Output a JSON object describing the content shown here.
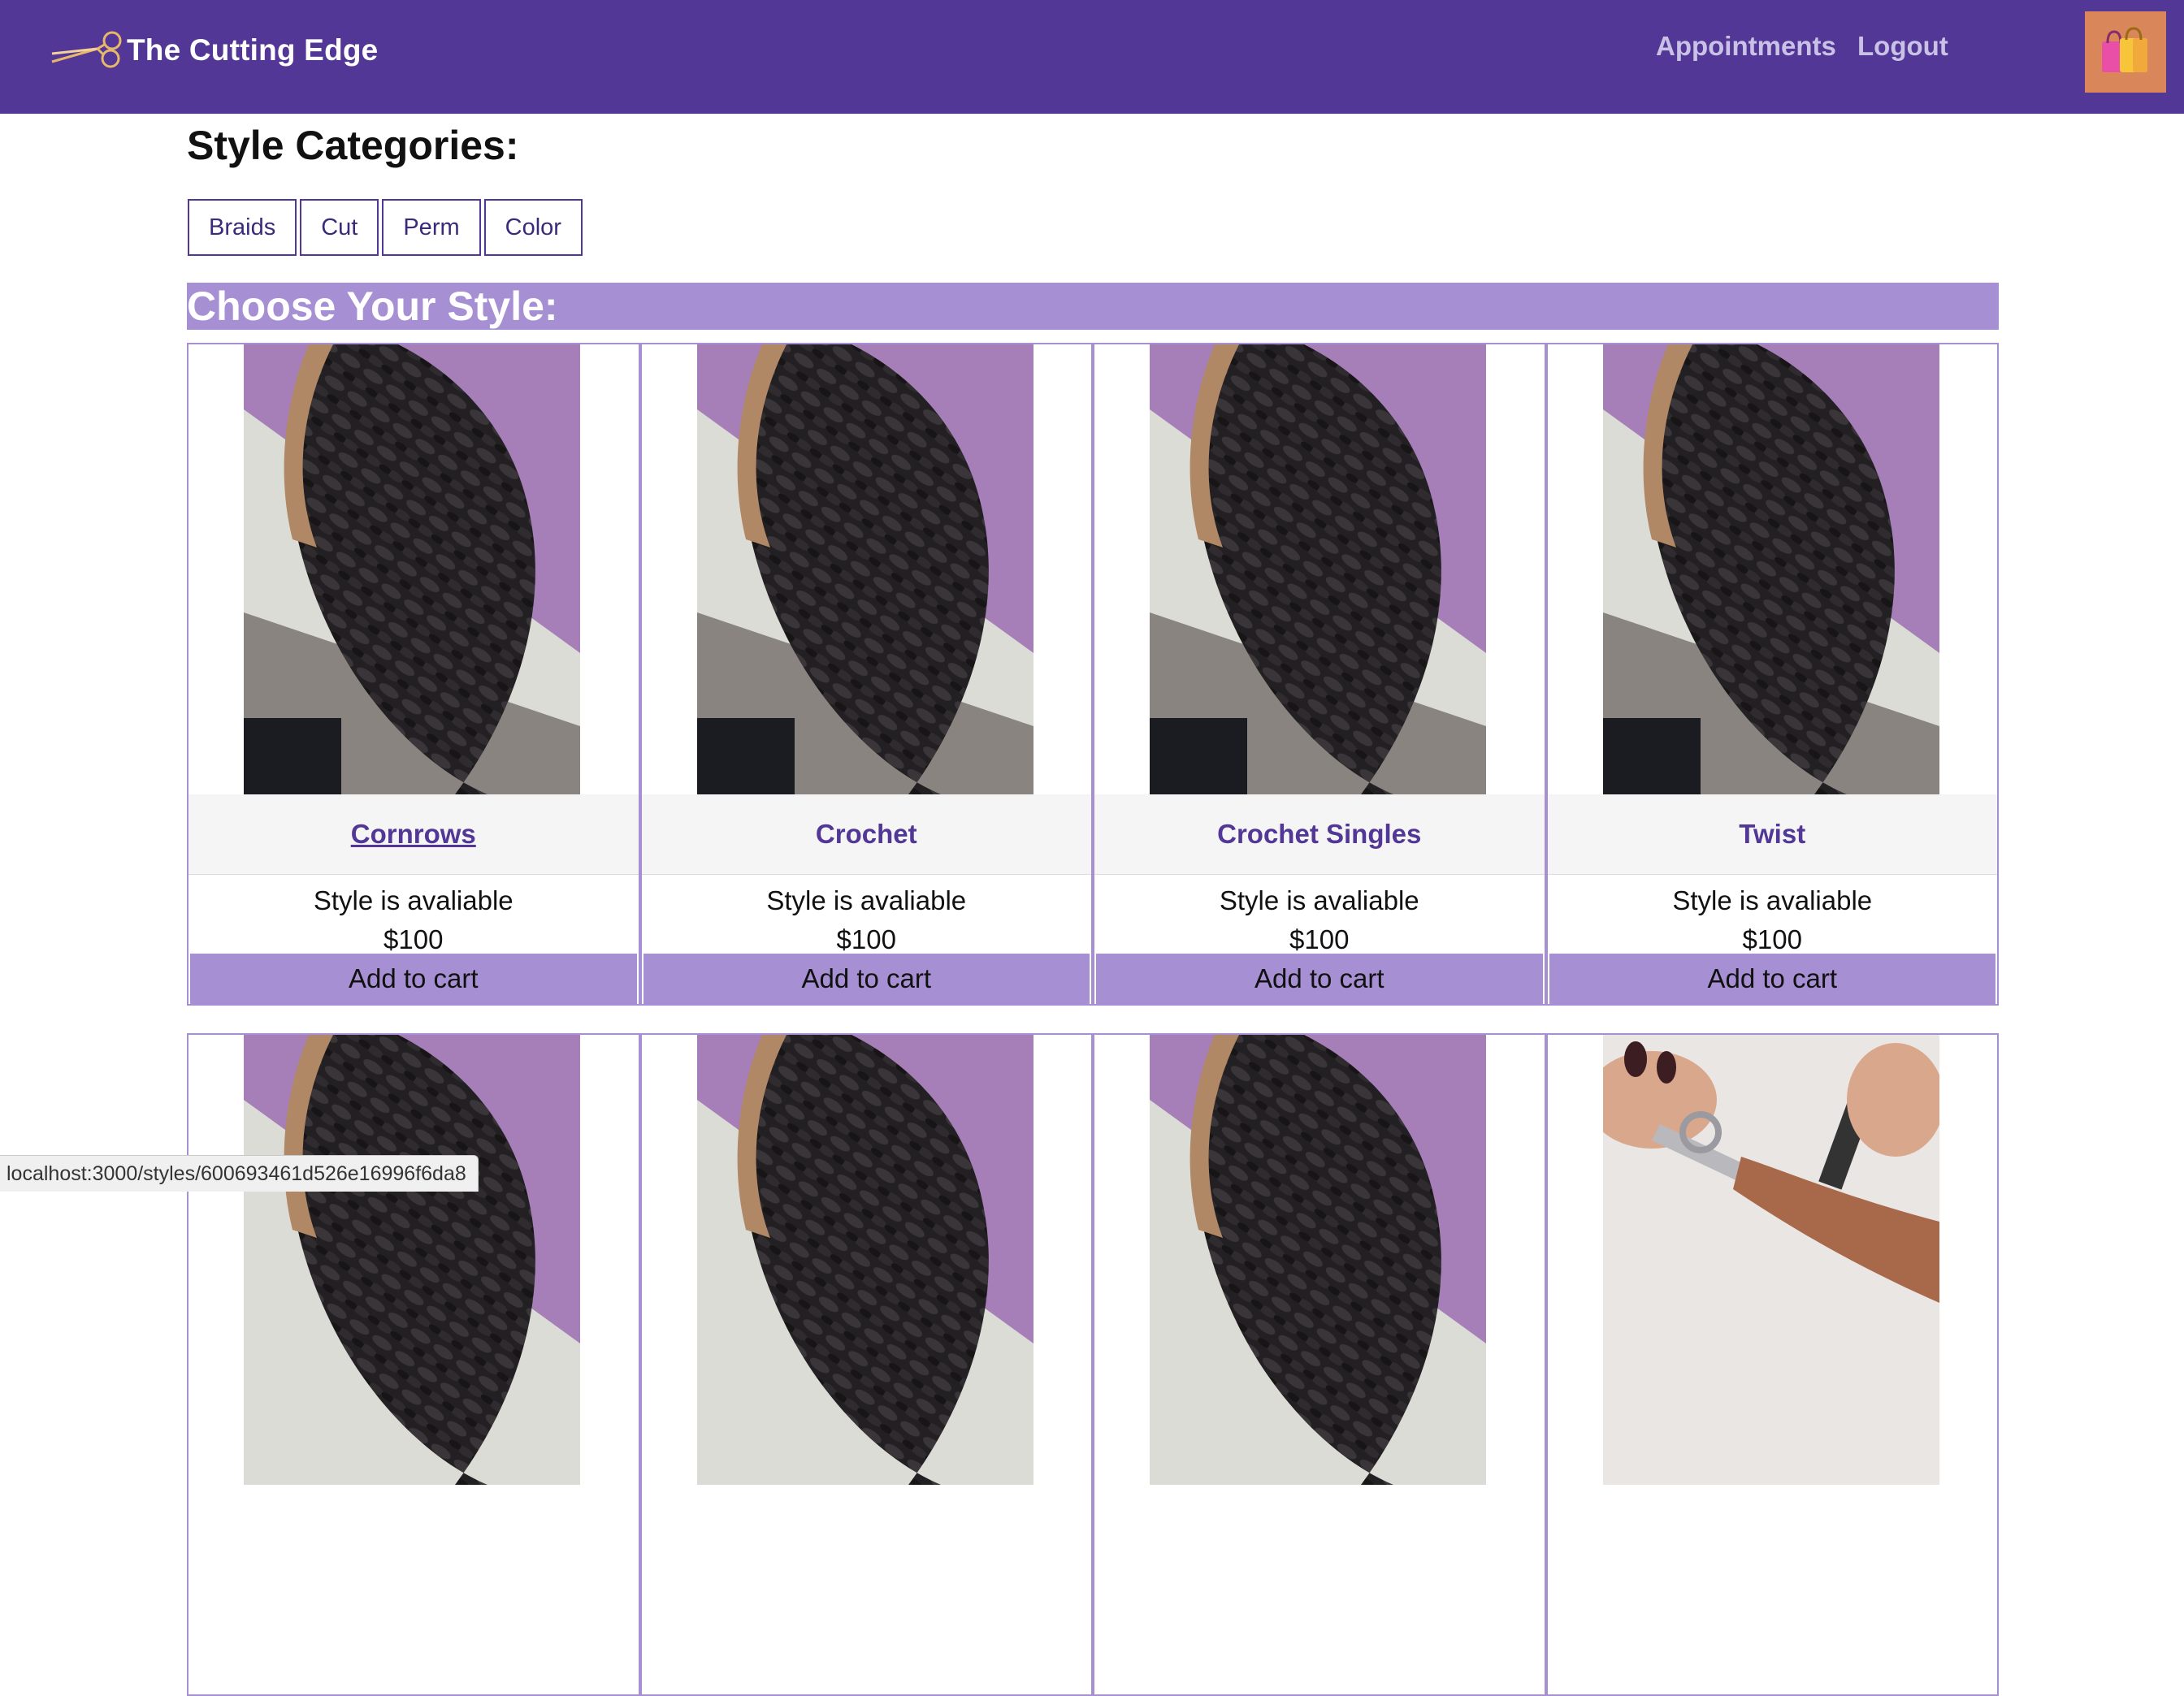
{
  "navbar": {
    "brand": "The Cutting Edge",
    "brand_icon": "scissors-icon",
    "links": [
      "Appointments",
      "Logout"
    ],
    "cart_icon": "shopping-bags-icon",
    "colors": {
      "bar": "#523796",
      "link": "#c9c2e6",
      "cart": "#d9875a"
    }
  },
  "categories": {
    "heading": "Style Categories:",
    "items": [
      "Braids",
      "Cut",
      "Perm",
      "Color"
    ]
  },
  "styles_section": {
    "heading": "Choose Your Style:",
    "accent": "#a690d3"
  },
  "cards": [
    {
      "title": "Cornrows",
      "status": "Style is avaliable",
      "price": "$100",
      "button": "Add to cart",
      "image": "braids-photo"
    },
    {
      "title": "Crochet",
      "status": "Style is avaliable",
      "price": "$100",
      "button": "Add to cart",
      "image": "braids-photo"
    },
    {
      "title": "Crochet Singles",
      "status": "Style is avaliable",
      "price": "$100",
      "button": "Add to cart",
      "image": "braids-photo"
    },
    {
      "title": "Twist",
      "status": "Style is avaliable",
      "price": "$100",
      "button": "Add to cart",
      "image": "braids-photo"
    },
    {
      "image": "braids-photo"
    },
    {
      "image": "braids-photo"
    },
    {
      "image": "braids-photo"
    },
    {
      "image": "haircut-scissors-photo"
    }
  ],
  "status_url": "localhost:3000/styles/600693461d526e16996f6da8"
}
